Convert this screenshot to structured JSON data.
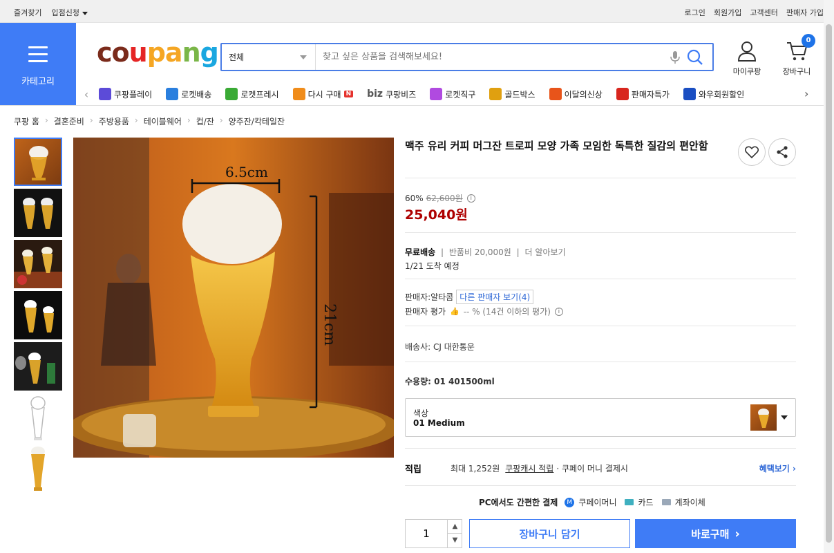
{
  "topbar": {
    "left": [
      "즐겨찾기",
      "입점신청"
    ],
    "right": [
      "로그인",
      "회원가입",
      "고객센터",
      "판매자 가입"
    ]
  },
  "category": {
    "label": "카테고리"
  },
  "logo": {
    "text": "coupang",
    "colors": [
      "#7b2b1b",
      "#e52525",
      "#f5a623",
      "#7ab648",
      "#1aa7e0"
    ]
  },
  "search": {
    "category": "전체",
    "placeholder": "찾고 싶은 상품을 검색해보세요!"
  },
  "header": {
    "my": "마이쿠팡",
    "cart": "장바구니",
    "cart_count": "0"
  },
  "nav": [
    {
      "label": "쿠팡플레이",
      "color": "#5c4bd8"
    },
    {
      "label": "로켓배송",
      "color": "#2a7fde"
    },
    {
      "label": "로켓프레시",
      "color": "#3aaa35"
    },
    {
      "label": "다시 구매",
      "color": "#f08c1a",
      "badge": "N"
    },
    {
      "label": "쿠팡비즈",
      "prefix": "biz",
      "color": "#444"
    },
    {
      "label": "로켓직구",
      "color": "#b04ae0"
    },
    {
      "label": "골드박스",
      "color": "#e0a010"
    },
    {
      "label": "이달의신상",
      "color": "#e8541a"
    },
    {
      "label": "판매자특가",
      "color": "#d8261e"
    },
    {
      "label": "와우회원할인",
      "color": "#1a4ec2"
    }
  ],
  "breadcrumb": [
    "쿠팡 홈",
    "결혼준비",
    "주방용품",
    "테이블웨어",
    "컵/잔",
    "양주잔/칵테일잔"
  ],
  "image": {
    "width_label": "6.5cm",
    "height_label": "21cm"
  },
  "product": {
    "title": "맥주 유리 커피 머그잔 트로피 모양 가족 모임한 독특한 질감의 편안함",
    "discount": "60%",
    "original_price": "62,600원",
    "price": "25,040원",
    "shipping_free": "무료배송",
    "return_fee": "반품비 20,000원",
    "learn_more": "더 알아보기",
    "arrival": "1/21 도착 예정",
    "seller_label": "판매자:알타콤",
    "other_sellers": "다른 판매자 보기(4)",
    "seller_rating_label": "판매자 평가",
    "seller_rating_value": "-- % (14건 이하의 평가)",
    "carrier": "배송사:  CJ 대한통운",
    "capacity": "수용량:  01 401500ml",
    "option_label": "색상",
    "option_value": "01 Medium",
    "reward_label": "적립",
    "reward_text": "최대 1,252원",
    "reward_link": "쿠팡캐시 적립",
    "reward_tail": "· 쿠페이 머니 결제시",
    "benefit": "혜택보기",
    "pay_title": "PC에서도 간편한 결제",
    "pay_methods": [
      "쿠페이머니",
      "카드",
      "계좌이체"
    ],
    "quantity": "1",
    "add_cart": "장바구니 담기",
    "buy_now": "바로구매"
  }
}
